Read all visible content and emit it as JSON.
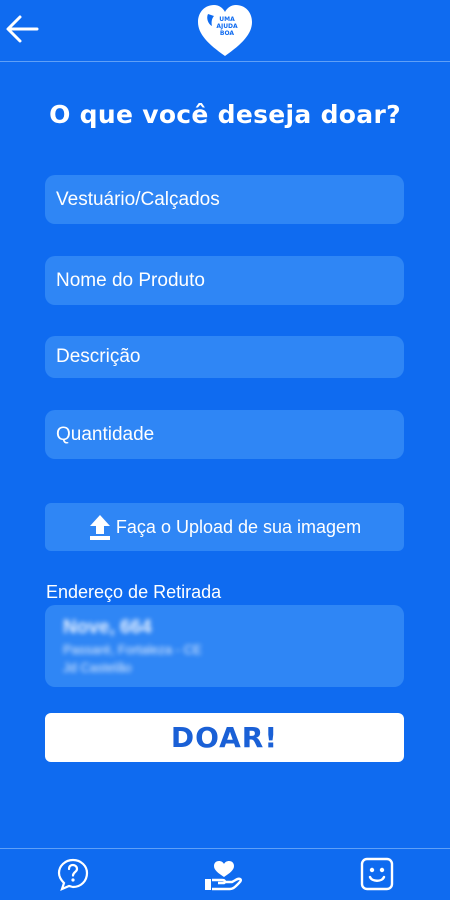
{
  "header": {
    "back_icon": "arrow-left-icon",
    "logo_lines": [
      "UMA",
      "AJUDA",
      "BOA"
    ]
  },
  "title": "O que você deseja doar?",
  "form": {
    "category": "Vestuário/Calçados",
    "product_name_placeholder": "Nome do Produto",
    "description_placeholder": "Descrição",
    "quantity_placeholder": "Quantidade",
    "upload_label": "Faça o Upload de sua imagem",
    "upload_icon": "upload-icon"
  },
  "address": {
    "label": "Endereço de Retirada",
    "line1": "Nove, 664",
    "line2": "Passaré, Fortaleza - CE",
    "line3": "Jd Castelão"
  },
  "donate_label": "DOAR!",
  "bottom_nav": {
    "items": [
      "help-icon",
      "donate-hand-heart-icon",
      "smile-face-icon"
    ]
  },
  "colors": {
    "background": "#0F6BF0",
    "field": "#2F86F5",
    "button_text": "#1A60D6"
  }
}
